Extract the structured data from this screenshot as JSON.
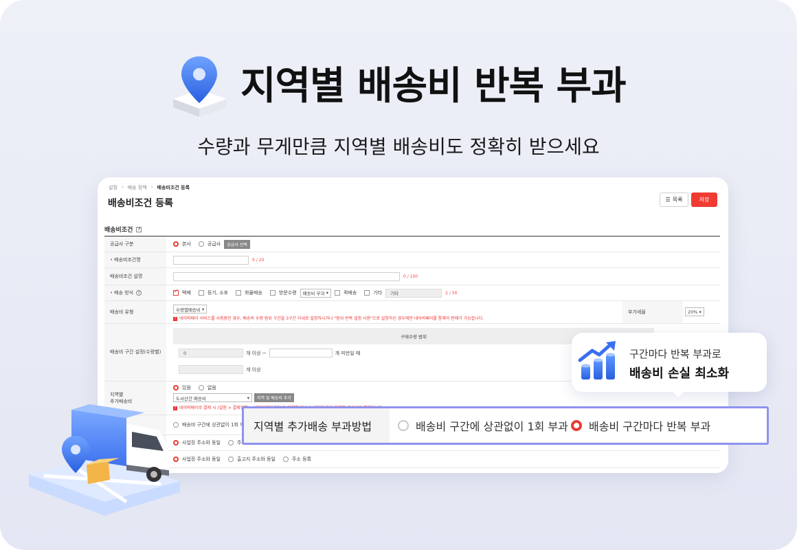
{
  "hero": {
    "title": "지역별 배송비 반복 부과",
    "subtitle": "수량과 무게만큼 지역별 배송비도 정확히 받으세요"
  },
  "card": {
    "breadcrumb": [
      "설정",
      "배송 정책",
      "배송비조건 등록"
    ],
    "page_title": "배송비조건 등록",
    "list_button": "목록",
    "save_button": "저장",
    "section_title": "배송비조건",
    "rows": {
      "supplier": {
        "label": "공급사 구분",
        "opt1": "본사",
        "opt2": "공급사",
        "btn": "공급사 선택"
      },
      "name": {
        "label": "배송비조건명",
        "count": "0 / 20"
      },
      "desc": {
        "label": "배송비조건 설명",
        "count": "0 / 100"
      },
      "method": {
        "label": "배송 방식",
        "opts": [
          "택배",
          "등기, 소포",
          "화물배송",
          "방문수령"
        ],
        "select": "배송비 부과",
        "opt5": "퀵배송",
        "opt6": "기타",
        "etc_value": "기타",
        "count": "2 / 50"
      },
      "fee_type": {
        "label": "배송비 유형",
        "select": "수량별배송비",
        "warning": "네이버페이 서비스를 사용중인 경우, 배송비 수량 범위 구간을 3구간 이내로 설정하시거나 \"범위 반복 설정 사용\"으로 설정하신 경우에만 네이버페이를 통해야 판매가 가능합니다.",
        "tax_label": "부가세율",
        "tax_value": "20%"
      },
      "range": {
        "label": "배송비 구간 설정(수량별)",
        "header": "구매수량 범위",
        "from_value": "0",
        "from_suffix": "개 이상 ~",
        "to_suffix": "개 미만일 때",
        "last_suffix": "개 이상"
      },
      "region": {
        "label_l1": "지역별",
        "label_l2": "추가배송비",
        "opt1": "있음",
        "opt2": "없음",
        "select": "도서산간 배송비",
        "btn": "지역 및 배송비 추가",
        "warning": "네이버페이로 결제 시 (설정 > 결제정책 > 네이버페이설정)의 지역별 배송비 설정에 따라 지역별 배송비가 책정됩니다."
      },
      "charge": {
        "opt1": "배송비 구간에 상관없이 1회 부과"
      },
      "addr1": {
        "opt1": "사업장 주소와 동일",
        "opt2": "주소 등록"
      },
      "addr2": {
        "opt1": "사업장 주소와 동일",
        "opt2": "출고지 주소와 동일",
        "opt3": "주소 등록"
      }
    }
  },
  "bubble": {
    "line1": "구간마다 반복 부과로",
    "line2": "배송비 손실 최소화"
  },
  "highlight": {
    "label": "지역별 추가배송 부과방법",
    "option1": "배송비 구간에 상관없이 1회 부과",
    "option2": "배송비 구간마다 반복 부과"
  },
  "colors": {
    "accent_red": "#ea3b32",
    "highlight_border": "#8d92ef",
    "background": "#e8eaf5"
  }
}
